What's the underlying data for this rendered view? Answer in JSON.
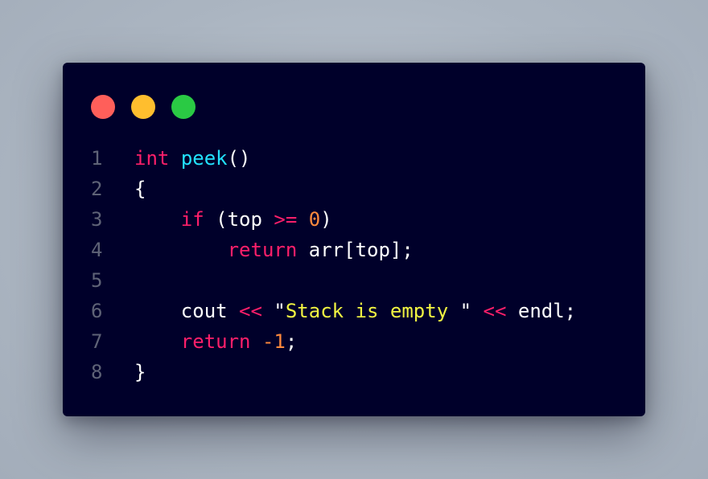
{
  "colors": {
    "background": "#abb5c1",
    "window": "#00002a",
    "line_number": "#5f6377",
    "plain": "#ffffff",
    "keyword": "#ff1f6a",
    "function": "#22e2ff",
    "number": "#ff8a3d",
    "string": "#f2f542",
    "dot_red": "#ff5f5a",
    "dot_yellow": "#ffbe2e",
    "dot_green": "#2aca44"
  },
  "window_controls": [
    {
      "name": "close-dot",
      "color": "#ff5f5a"
    },
    {
      "name": "minimize-dot",
      "color": "#ffbe2e"
    },
    {
      "name": "maximize-dot",
      "color": "#2aca44"
    }
  ],
  "code": {
    "lines": [
      {
        "number": "1",
        "tokens": [
          {
            "t": "int",
            "k": "keyword"
          },
          {
            "t": " ",
            "k": "plain"
          },
          {
            "t": "peek",
            "k": "func"
          },
          {
            "t": "()",
            "k": "plain"
          }
        ]
      },
      {
        "number": "2",
        "tokens": [
          {
            "t": "{",
            "k": "plain"
          }
        ]
      },
      {
        "number": "3",
        "tokens": [
          {
            "t": "    ",
            "k": "plain"
          },
          {
            "t": "if",
            "k": "keyword"
          },
          {
            "t": " (top ",
            "k": "plain"
          },
          {
            "t": ">=",
            "k": "keyword"
          },
          {
            "t": " ",
            "k": "plain"
          },
          {
            "t": "0",
            "k": "number"
          },
          {
            "t": ")",
            "k": "plain"
          }
        ]
      },
      {
        "number": "4",
        "tokens": [
          {
            "t": "        ",
            "k": "plain"
          },
          {
            "t": "return",
            "k": "keyword"
          },
          {
            "t": " arr[top];",
            "k": "plain"
          }
        ]
      },
      {
        "number": "5",
        "tokens": []
      },
      {
        "number": "6",
        "tokens": [
          {
            "t": "    cout ",
            "k": "plain"
          },
          {
            "t": "<<",
            "k": "keyword"
          },
          {
            "t": " \"",
            "k": "plain"
          },
          {
            "t": "Stack is empty",
            "k": "string"
          },
          {
            "t": " \" ",
            "k": "plain"
          },
          {
            "t": "<<",
            "k": "keyword"
          },
          {
            "t": " endl;",
            "k": "plain"
          }
        ]
      },
      {
        "number": "7",
        "tokens": [
          {
            "t": "    ",
            "k": "plain"
          },
          {
            "t": "return",
            "k": "keyword"
          },
          {
            "t": " ",
            "k": "plain"
          },
          {
            "t": "-1",
            "k": "number"
          },
          {
            "t": ";",
            "k": "plain"
          }
        ]
      },
      {
        "number": "8",
        "tokens": [
          {
            "t": "}",
            "k": "plain"
          }
        ]
      }
    ]
  }
}
